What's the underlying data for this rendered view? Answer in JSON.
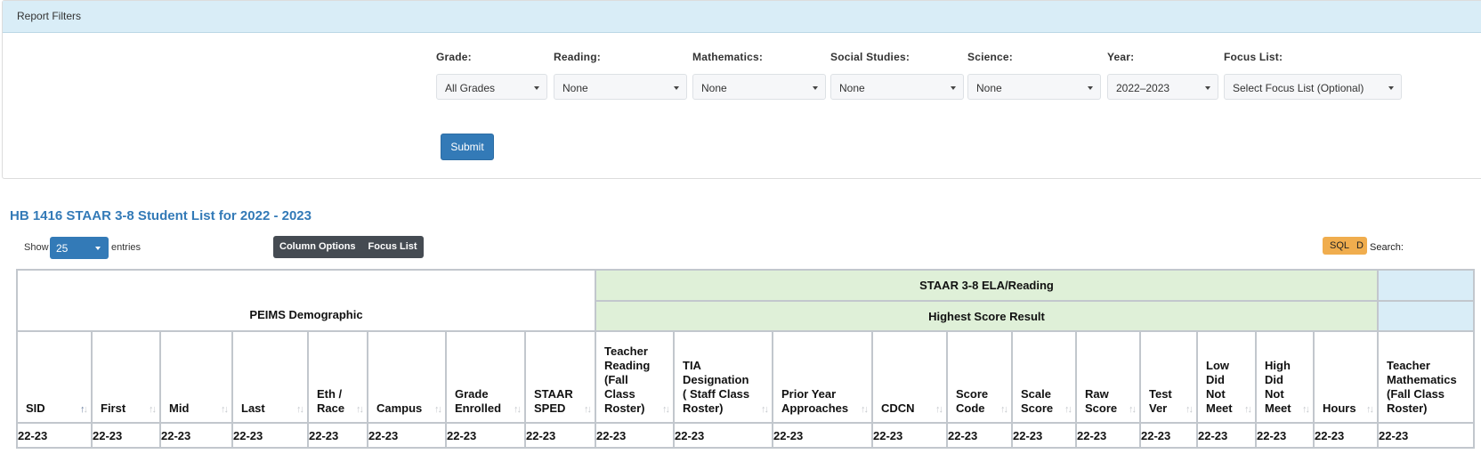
{
  "filters": {
    "panel_title": "Report Filters",
    "groups": [
      {
        "label": "Grade:",
        "value": "All Grades"
      },
      {
        "label": "Reading:",
        "value": "None"
      },
      {
        "label": "Mathematics:",
        "value": "None"
      },
      {
        "label": "Social Studies:",
        "value": "None"
      },
      {
        "label": "Science:",
        "value": "None"
      },
      {
        "label": "Year:",
        "value": "2022–2023"
      },
      {
        "label": "Focus List:",
        "value": "Select Focus List (Optional)"
      }
    ],
    "submit_label": "Submit"
  },
  "report": {
    "title": "HB 1416 STAAR 3-8 Student List for 2022 - 2023",
    "show_label": "Show",
    "entries_value": "25",
    "entries_label": "entries",
    "column_options_label": "Column Options",
    "focus_list_label": "Focus List",
    "sql_label": "SQL",
    "d_label": "D",
    "search_label": "Search:"
  },
  "table": {
    "group_headers": {
      "demographic": "PEIMS Demographic",
      "ela": "STAAR 3-8 ELA/Reading",
      "ela_sub": "Highest Score Result",
      "next": ""
    },
    "columns": [
      "SID",
      "First",
      "Mid",
      "Last",
      "Eth / Race",
      "Campus",
      "Grade Enrolled",
      "STAAR SPED",
      "Teacher Reading (Fall Class Roster)",
      "TIA Designation ( Staff Class Roster)",
      "Prior Year Approaches",
      "CDCN",
      "Score Code",
      "Scale Score",
      "Raw Score",
      "Test Ver",
      "Low Did Not Meet",
      "High Did Not Meet",
      "Hours",
      "Teacher Mathematics (Fall Class Roster)"
    ],
    "rows": [
      [
        "22-23",
        "22-23",
        "22-23",
        "22-23",
        "22-23",
        "22-23",
        "22-23",
        "22-23",
        "22-23",
        "22-23",
        "22-23",
        "22-23",
        "22-23",
        "22-23",
        "22-23",
        "22-23",
        "22-23",
        "22-23",
        "22-23",
        "22-23"
      ]
    ],
    "sorted_column": "SID"
  },
  "icons": {
    "caret": "caret-down-icon",
    "sort": "sort-arrows-icon"
  }
}
